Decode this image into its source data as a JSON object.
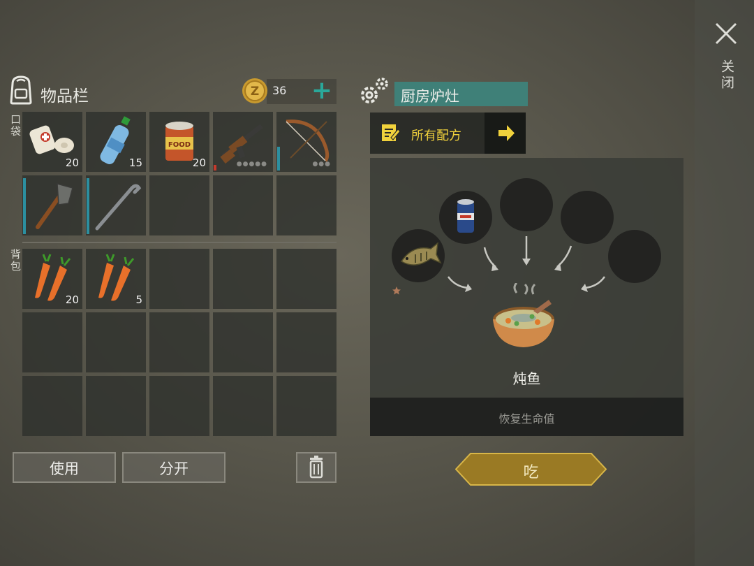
{
  "inventory": {
    "title": "物品栏",
    "coins": "36",
    "pocket_label": "口袋",
    "backpack_label": "背包",
    "pocket_slots": [
      {
        "item": "bandage-icon",
        "count": "20"
      },
      {
        "item": "water-bottle-icon",
        "count": "15"
      },
      {
        "item": "canned-food-icon",
        "count": "20"
      },
      {
        "item": "rifle-icon",
        "count": ""
      },
      {
        "item": "bow-icon",
        "count": ""
      },
      {
        "item": "shovel-icon",
        "count": ""
      },
      {
        "item": "crowbar-icon",
        "count": ""
      },
      {
        "item": "",
        "count": ""
      },
      {
        "item": "",
        "count": ""
      },
      {
        "item": "",
        "count": ""
      }
    ],
    "backpack_slots": [
      {
        "item": "carrot-icon",
        "count": "20"
      },
      {
        "item": "carrot-icon",
        "count": "5"
      }
    ],
    "use_label": "使用",
    "split_label": "分开"
  },
  "station": {
    "title": "厨房炉灶",
    "recipes_label": "所有配方",
    "recipe_name": "炖鱼",
    "recipe_desc": "恢复生命值",
    "eat_label": "吃",
    "ingredients": [
      "fish-icon",
      "beer-can-icon",
      "",
      "",
      ""
    ]
  },
  "close_label": "关闭",
  "colors": {
    "accent_teal": "#3f8078",
    "recipe_yellow": "#f1d23c",
    "eat_gold": "#b08a2a"
  }
}
